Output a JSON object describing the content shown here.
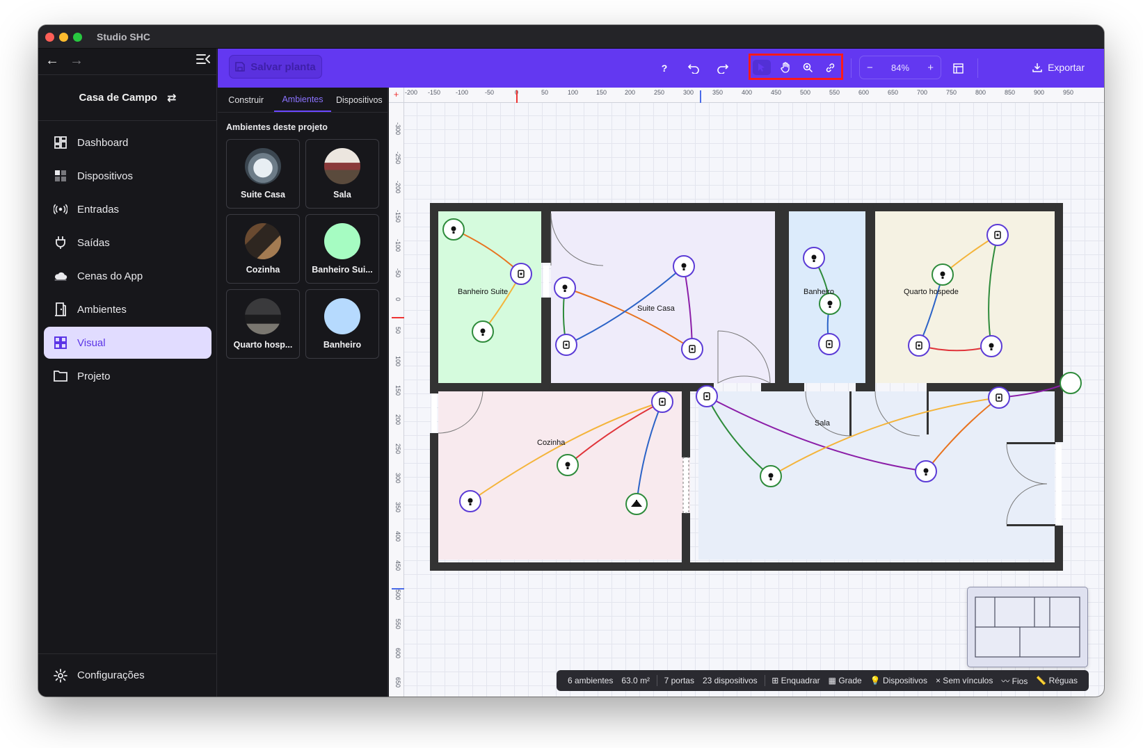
{
  "window": {
    "title": "Studio SHC"
  },
  "sidebar": {
    "project_name": "Casa de Campo",
    "items": [
      {
        "label": "Dashboard",
        "icon": "dashboard-icon"
      },
      {
        "label": "Dispositivos",
        "icon": "devices-icon"
      },
      {
        "label": "Entradas",
        "icon": "broadcast-icon"
      },
      {
        "label": "Saídas",
        "icon": "plug-icon"
      },
      {
        "label": "Cenas do App",
        "icon": "cloud-icon"
      },
      {
        "label": "Ambientes",
        "icon": "door-icon"
      },
      {
        "label": "Visual",
        "icon": "grid-icon",
        "active": true
      },
      {
        "label": "Projeto",
        "icon": "folder-icon"
      }
    ],
    "settings_label": "Configurações"
  },
  "toolbar": {
    "save_label": "Salvar planta",
    "help_label": "?",
    "zoom": "84%",
    "zoom_minus": "−",
    "zoom_plus": "+",
    "export_label": "Exportar",
    "accent": "#6338f1",
    "highlight": "#ff1a1a"
  },
  "panel": {
    "tabs": [
      {
        "label": "Construir"
      },
      {
        "label": "Ambientes",
        "active": true
      },
      {
        "label": "Dispositivos"
      }
    ],
    "title": "Ambientes deste projeto",
    "cards": [
      {
        "label": "Suite Casa",
        "thumb": "photo"
      },
      {
        "label": "Sala",
        "thumb": "photo"
      },
      {
        "label": "Cozinha",
        "thumb": "photo"
      },
      {
        "label": "Banheiro Sui...",
        "thumb": "#a6fcc2"
      },
      {
        "label": "Quarto hosp...",
        "thumb": "photo"
      },
      {
        "label": "Banheiro",
        "thumb": "#b6dafe"
      }
    ]
  },
  "rulers": {
    "top": [
      "-200",
      "-150",
      "-100",
      "-50",
      "0",
      "50",
      "100",
      "150",
      "200",
      "250",
      "300",
      "350",
      "400",
      "450",
      "500",
      "550",
      "600",
      "650",
      "700",
      "750",
      "800",
      "850",
      "900",
      "950"
    ],
    "left": [
      "-300",
      "-250",
      "-200",
      "-150",
      "-100",
      "-50",
      "0",
      "50",
      "100",
      "150",
      "200",
      "250",
      "300",
      "350",
      "400",
      "450",
      "500",
      "550",
      "600",
      "650"
    ]
  },
  "rooms": [
    {
      "name": "Banheiro Suite",
      "color": "#d5fbdd"
    },
    {
      "name": "Suite Casa",
      "color": "#efecfa"
    },
    {
      "name": "Banheiro",
      "color": "#dcebfb"
    },
    {
      "name": "Quarto hospede",
      "color": "#f5f2e3"
    },
    {
      "name": "Cozinha",
      "color": "#f8eaee"
    },
    {
      "name": "Sala",
      "color": "#e8eef9"
    }
  ],
  "statusbar": {
    "rooms": "6 ambientes",
    "area": "63.0 m²",
    "doors": "7 portas",
    "devices": "23 dispositivos",
    "fit": "⊞ Enquadrar",
    "grid": "▦ Grade",
    "devices_toggle": "💡 Dispositivos",
    "no_links": "× Sem vínculos",
    "wires": "〰 Fios",
    "rulers": "📏 Réguas"
  }
}
